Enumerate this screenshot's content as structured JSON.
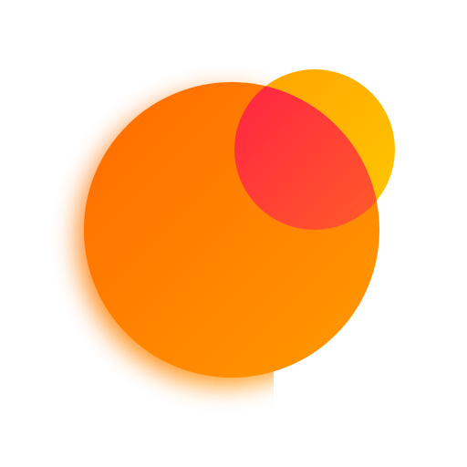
{
  "logo": {
    "description_icon": "overlapping-circles-logo-icon",
    "colors": {
      "background": "#ffffff",
      "large_circle_start": "#FF6A00",
      "large_circle_end": "#FF9A00",
      "small_circle_start": "#FFA200",
      "small_circle_end": "#FFC800",
      "overlap_start": "#FF1A4A",
      "overlap_end": "#FF5A2A"
    }
  }
}
